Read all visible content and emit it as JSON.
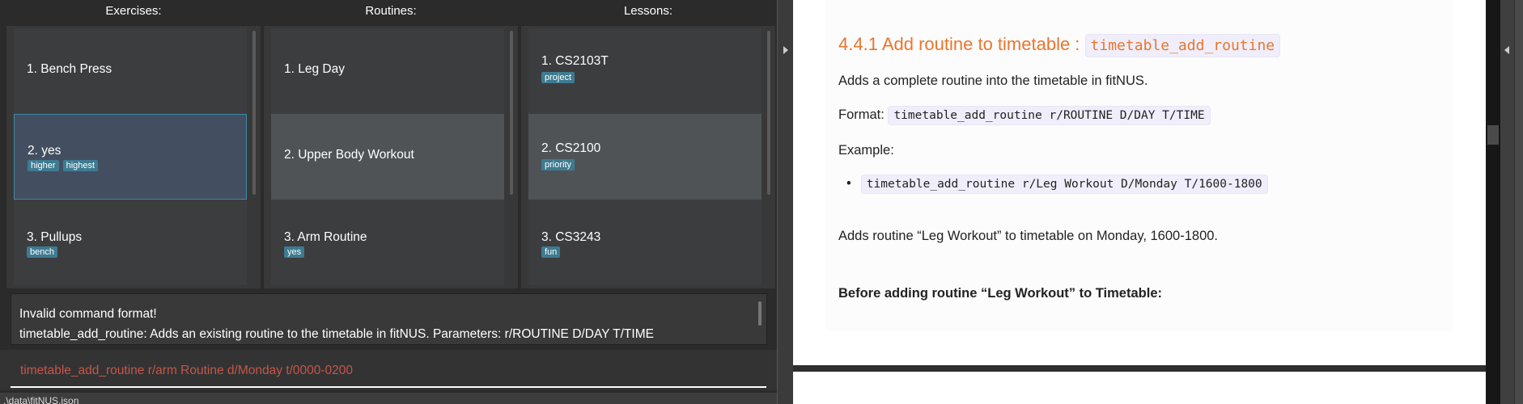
{
  "columns": {
    "exercises": "Exercises:",
    "routines": "Routines:",
    "lessons": "Lessons:"
  },
  "exercises": [
    {
      "label": "1.  Bench Press",
      "tags": []
    },
    {
      "label": "2.  yes",
      "tags": [
        "higher",
        "highest"
      ]
    },
    {
      "label": "3.  Pullups",
      "tags": [
        "bench"
      ]
    }
  ],
  "routines": [
    {
      "label": "1.  Leg Day",
      "tags": []
    },
    {
      "label": "2.  Upper Body Workout",
      "tags": []
    },
    {
      "label": "3.  Arm Routine",
      "tags": [
        "yes"
      ]
    }
  ],
  "lessons": [
    {
      "label": "1.  CS2103T",
      "tags": [
        "project"
      ]
    },
    {
      "label": "2.  CS2100",
      "tags": [
        "priority"
      ]
    },
    {
      "label": "3.  CS3243",
      "tags": [
        "fun"
      ]
    }
  ],
  "result": {
    "line1": "Invalid command format!",
    "line2": "timetable_add_routine: Adds an existing routine to the timetable in fitNUS. Parameters: r/ROUTINE D/DAY T/TIME"
  },
  "command": {
    "value": "timetable_add_routine r/arm Routine d/Monday t/0000-0200"
  },
  "status": {
    "path": ".\\data\\fitNUS.json"
  },
  "doc": {
    "heading": "4.4.1 Add routine to timetable :",
    "heading_code": "timetable_add_routine",
    "intro": "Adds a complete routine into the timetable in fitNUS.",
    "format_label": "Format:",
    "format_code": "timetable_add_routine r/ROUTINE D/DAY T/TIME",
    "example_label": "Example:",
    "example_code": "timetable_add_routine r/Leg Workout D/Monday T/1600-1800",
    "example_desc": "Adds routine “Leg Workout” to timetable on Monday, 1600-1800.",
    "before": "Before adding routine “Leg Workout” to Timetable:"
  },
  "colors": {
    "accent": "#e8762d",
    "tag": "#3e7b91",
    "error_text": "#c4564a",
    "selected": "#434f60"
  }
}
